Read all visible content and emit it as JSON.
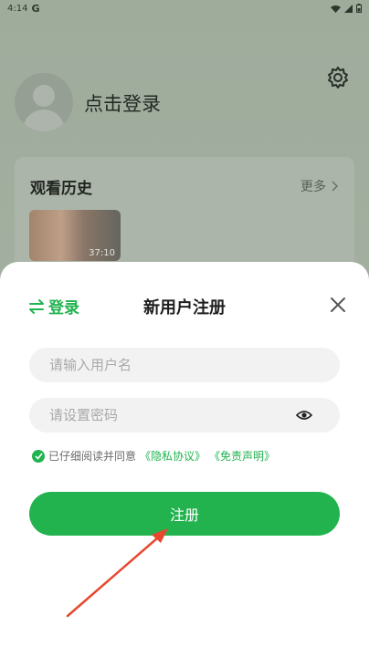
{
  "status_bar": {
    "time": "4:14",
    "g_icon": "G"
  },
  "profile": {
    "login_prompt": "点击登录",
    "settings_icon": "gear-icon"
  },
  "history": {
    "title": "观看历史",
    "more_label": "更多",
    "thumb_duration": "37:10"
  },
  "sheet": {
    "switch_label": "登录",
    "title": "新用户注册",
    "username_placeholder": "请输入用户名",
    "password_placeholder": "请设置密码",
    "agreement_prefix": "已仔细阅读并同意",
    "privacy_link": "《隐私协议》",
    "disclaimer_link": "《免责声明》",
    "register_label": "注册"
  },
  "colors": {
    "accent": "#21b34f",
    "annotation_arrow": "#e8472f"
  }
}
